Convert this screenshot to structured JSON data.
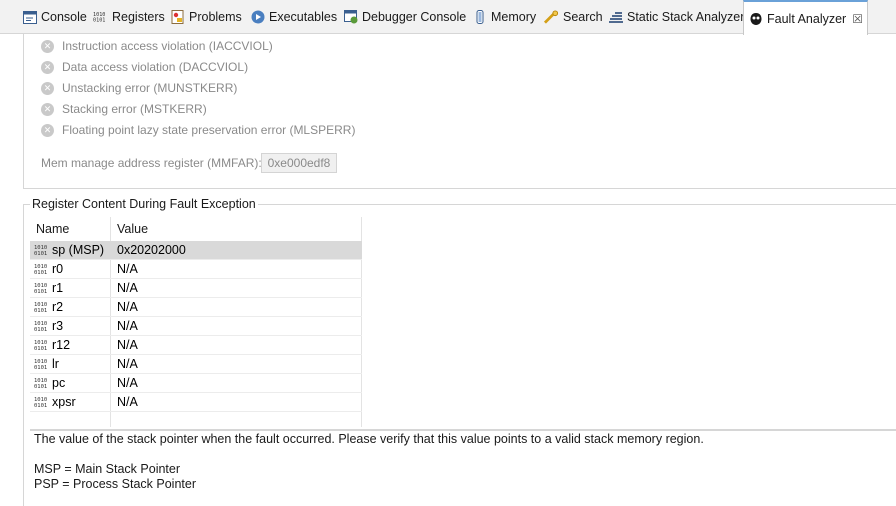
{
  "tabs": [
    {
      "label": "Console",
      "icon": "console-icon"
    },
    {
      "label": "Registers",
      "icon": "registers-icon"
    },
    {
      "label": "Problems",
      "icon": "problems-icon"
    },
    {
      "label": "Executables",
      "icon": "executables-icon"
    },
    {
      "label": "Debugger Console",
      "icon": "debugger-console-icon"
    },
    {
      "label": "Memory",
      "icon": "memory-icon"
    },
    {
      "label": "Search",
      "icon": "search-icon"
    },
    {
      "label": "Static Stack Analyzer",
      "icon": "stack-analyzer-icon"
    },
    {
      "label": "Fault Analyzer",
      "icon": "fault-analyzer-icon",
      "active": true
    }
  ],
  "close_glyph": "☒",
  "errors": [
    {
      "label": "Instruction access violation (IACCVIOL)"
    },
    {
      "label": "Data access violation (DACCVIOL)"
    },
    {
      "label": "Unstacking error (MUNSTKERR)"
    },
    {
      "label": "Stacking error (MSTKERR)"
    },
    {
      "label": "Floating point lazy state preservation error (MLSPERR)"
    }
  ],
  "mmfar": {
    "label": "Mem manage address register (MMFAR):",
    "value": "0xe000edf8"
  },
  "register_group": {
    "title": "Register Content During Fault Exception",
    "columns": {
      "name": "Name",
      "value": "Value"
    },
    "rows": [
      {
        "name": "sp (MSP)",
        "value": "0x20202000",
        "selected": true
      },
      {
        "name": "r0",
        "value": "N/A"
      },
      {
        "name": "r1",
        "value": "N/A"
      },
      {
        "name": "r2",
        "value": "N/A"
      },
      {
        "name": "r3",
        "value": "N/A"
      },
      {
        "name": "r12",
        "value": "N/A"
      },
      {
        "name": "lr",
        "value": "N/A"
      },
      {
        "name": "pc",
        "value": "N/A"
      },
      {
        "name": "xpsr",
        "value": "N/A"
      }
    ]
  },
  "description": "The value of the stack pointer when the fault occurred. Please verify that this value points to a valid stack memory region.",
  "legend": [
    "MSP = Main Stack Pointer",
    "PSP = Process Stack Pointer"
  ],
  "colors": {
    "active_tab_accent": "#6aa1d8",
    "selected_row": "#d9d9d9",
    "disabled_text": "#8a8a8a"
  }
}
